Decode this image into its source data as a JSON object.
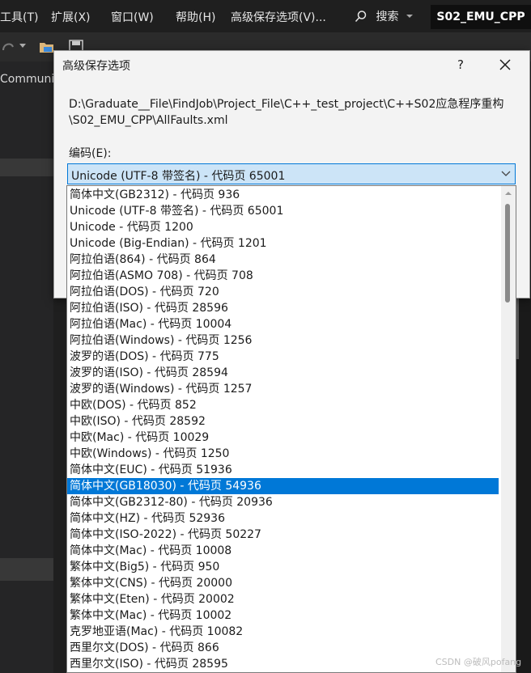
{
  "menubar": {
    "items": [
      "工具(T)",
      "扩展(X)",
      "窗口(W)",
      "帮助(H)",
      "高级保存选项(V)..."
    ],
    "search_label": "搜索",
    "project_name": "S02_EMU_CPP"
  },
  "left_panel": {
    "tab_label": "Communi"
  },
  "dialog": {
    "title": "高级保存选项",
    "help_label": "?",
    "path_text": "D:\\Graduate__File\\FindJob\\Project_File\\C++_test_project\\C++S02应急程序重构\\S02_EMU_CPP\\AllFaults.xml",
    "encoding_label": "编码(E):",
    "encoding_value": "Unicode (UTF-8 带签名) - 代码页 65001"
  },
  "encoding_options": [
    "简体中文(GB2312) - 代码页 936",
    "Unicode (UTF-8 带签名) - 代码页 65001",
    "Unicode - 代码页 1200",
    "Unicode (Big-Endian) - 代码页 1201",
    "阿拉伯语(864) - 代码页 864",
    "阿拉伯语(ASMO 708) - 代码页 708",
    "阿拉伯语(DOS) - 代码页 720",
    "阿拉伯语(ISO) - 代码页 28596",
    "阿拉伯语(Mac) - 代码页 10004",
    "阿拉伯语(Windows) - 代码页 1256",
    "波罗的语(DOS) - 代码页 775",
    "波罗的语(ISO) - 代码页 28594",
    "波罗的语(Windows) - 代码页 1257",
    "中欧(DOS) - 代码页 852",
    "中欧(ISO) - 代码页 28592",
    "中欧(Mac) - 代码页 10029",
    "中欧(Windows) - 代码页 1250",
    "简体中文(EUC) - 代码页 51936",
    "简体中文(GB18030) - 代码页 54936",
    "简体中文(GB2312-80) - 代码页 20936",
    "简体中文(HZ) - 代码页 52936",
    "简体中文(ISO-2022) - 代码页 50227",
    "简体中文(Mac) - 代码页 10008",
    "繁体中文(Big5) - 代码页 950",
    "繁体中文(CNS) - 代码页 20000",
    "繁体中文(Eten) - 代码页 20002",
    "繁体中文(Mac) - 代码页 10002",
    "克罗地亚语(Mac) - 代码页 10082",
    "西里尔文(DOS) - 代码页 866",
    "西里尔文(ISO) - 代码页 28595"
  ],
  "selected_option": "简体中文(GB18030) - 代码页 54936",
  "watermark": "CSDN @破风pofang",
  "colors": {
    "selection": "#0078d7",
    "combo_bg": "#cce4f7",
    "vs_background": "#1f1f1f"
  },
  "icons": [
    "search-icon",
    "close-icon",
    "chevron-down-icon",
    "folder-icon",
    "save-icon"
  ]
}
